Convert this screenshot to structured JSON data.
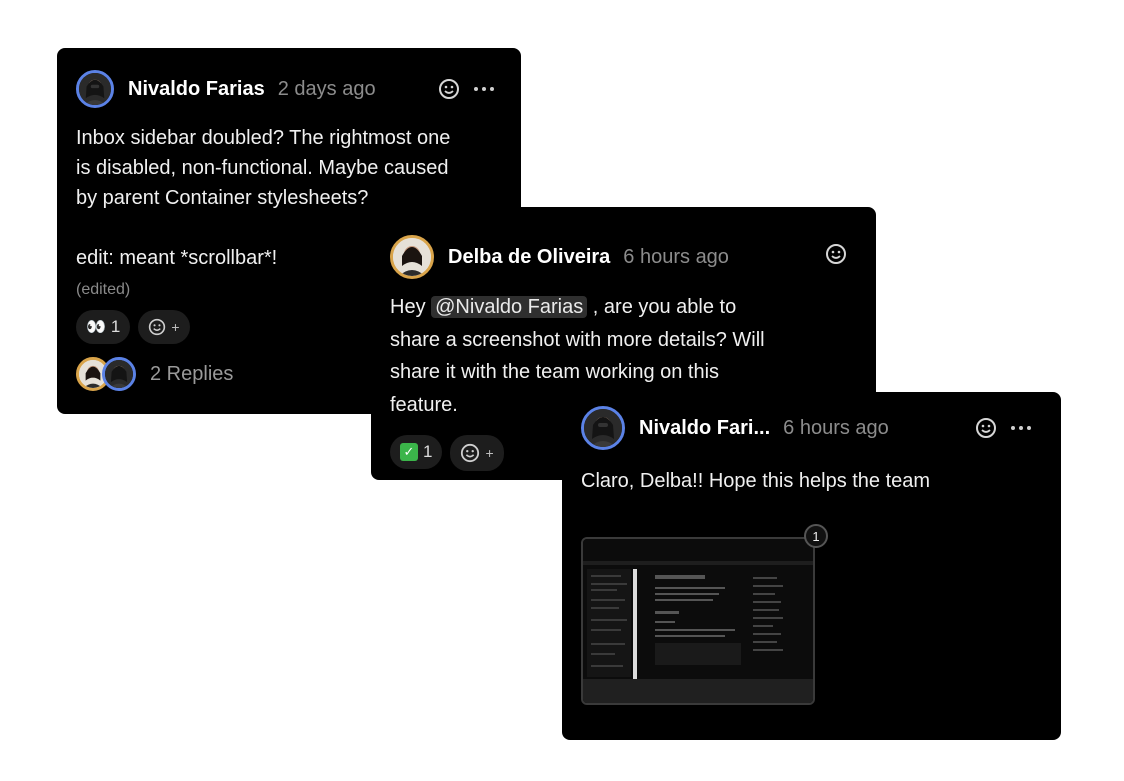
{
  "comments": [
    {
      "author": "Nivaldo Farias",
      "time": "2 days ago",
      "body": "Inbox sidebar doubled? The rightmost one\nis disabled, non-functional. Maybe caused\nby parent Container stylesheets?\n\nedit: meant *scrollbar*!",
      "edited_label": "(edited)",
      "reaction": {
        "emoji_name": "eyes",
        "count": "1"
      },
      "add_reaction_label": "+",
      "replies_label": "2 Replies"
    },
    {
      "author": "Delba de Oliveira",
      "time": "6 hours ago",
      "body_prefix": "Hey ",
      "mention": "@Nivaldo Farias",
      "body_suffix": " , are you able to\nshare a screenshot with more details? Will\nshare it with the team working on this\nfeature.",
      "reaction": {
        "emoji_name": "white-check-mark",
        "count": "1"
      },
      "add_reaction_label": "+"
    },
    {
      "author": "Nivaldo Fari...",
      "time": "6 hours ago",
      "body": "Claro, Delba!! Hope this helps the team",
      "attachment_count": "1"
    }
  ],
  "colors": {
    "card_bg": "#000000",
    "avatar_ring_blue": "#5b82e6",
    "avatar_ring_gold": "#d9a44a",
    "check_green": "#3bb54a"
  },
  "icons": [
    "emoji-smile-icon",
    "more-horizontal-icon",
    "eyes-emoji",
    "check-mark-emoji",
    "attachment-thumbnail"
  ]
}
